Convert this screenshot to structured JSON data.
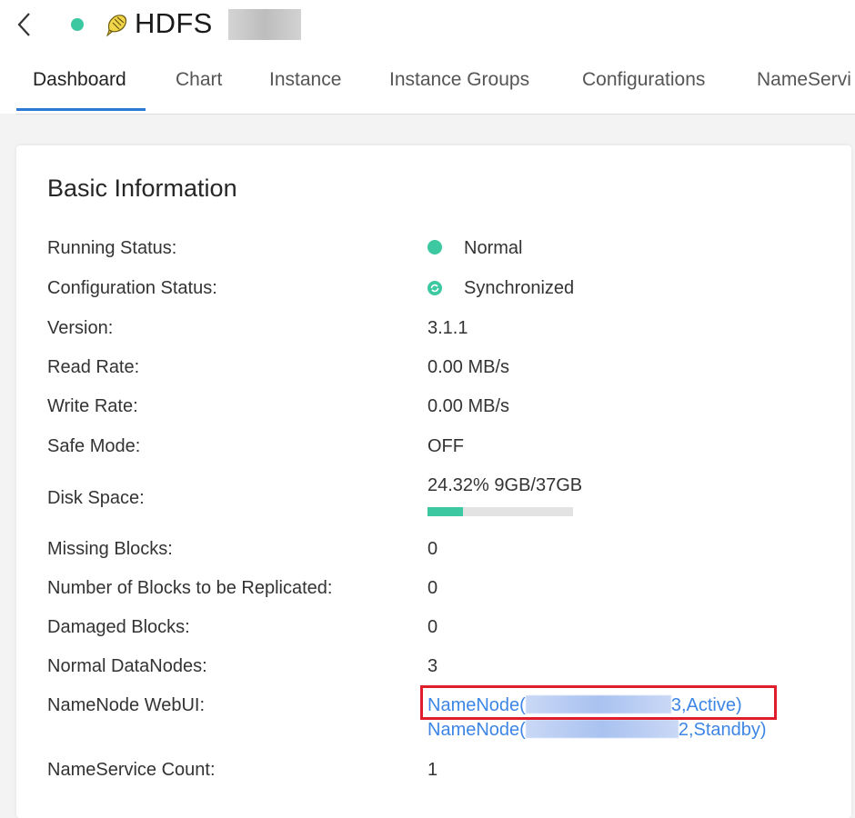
{
  "header": {
    "title": "HDFS",
    "status_color": "#3cc8a0",
    "back_icon": "chevron-left-icon",
    "service_icon": "hdfs-elephant-icon"
  },
  "tabs": [
    {
      "label": "Dashboard",
      "active": true
    },
    {
      "label": "Chart",
      "active": false
    },
    {
      "label": "Instance",
      "active": false
    },
    {
      "label": "Instance Groups",
      "active": false
    },
    {
      "label": "Configurations",
      "active": false
    },
    {
      "label": "NameServi",
      "active": false
    }
  ],
  "basic_info": {
    "title": "Basic Information",
    "running_status": {
      "label": "Running Status:",
      "value": "Normal"
    },
    "config_status": {
      "label": "Configuration Status:",
      "value": "Synchronized"
    },
    "version": {
      "label": "Version:",
      "value": "3.1.1"
    },
    "read_rate": {
      "label": "Read Rate:",
      "value": "0.00 MB/s"
    },
    "write_rate": {
      "label": "Write Rate:",
      "value": "0.00 MB/s"
    },
    "safe_mode": {
      "label": "Safe Mode:",
      "value": "OFF"
    },
    "disk_space": {
      "label": "Disk Space:",
      "value": "24.32% 9GB/37GB",
      "percent": 24.32
    },
    "missing_blocks": {
      "label": "Missing Blocks:",
      "value": "0"
    },
    "blocks_to_replicate": {
      "label": "Number of Blocks to be Replicated:",
      "value": "0"
    },
    "damaged_blocks": {
      "label": "Damaged Blocks:",
      "value": "0"
    },
    "normal_datanodes": {
      "label": "Normal DataNodes:",
      "value": "3"
    },
    "namenode_webui": {
      "label": "NameNode WebUI:",
      "links": [
        {
          "prefix": "NameNode(",
          "suffix": "3,Active)"
        },
        {
          "prefix": "NameNode(",
          "suffix": "2,Standby)"
        }
      ]
    },
    "nameservice_count": {
      "label": "NameService Count:",
      "value": "1"
    }
  },
  "colors": {
    "accent": "#2d7ad6",
    "normal": "#3cc8a0",
    "link": "#3d86e6",
    "highlight": "#e01e2b"
  }
}
